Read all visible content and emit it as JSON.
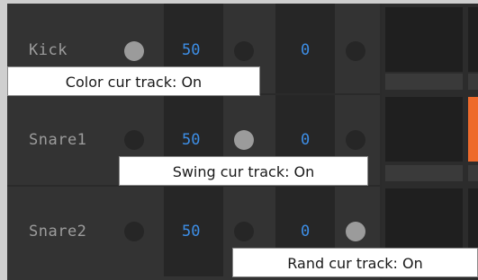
{
  "tracks": [
    {
      "name": "Kick",
      "swing": "50",
      "rand": "0",
      "color_dot_on": true,
      "swing_dot_on": false,
      "rand_dot_on": false
    },
    {
      "name": "Snare1",
      "swing": "50",
      "rand": "0",
      "color_dot_on": false,
      "swing_dot_on": true,
      "rand_dot_on": false
    },
    {
      "name": "Snare2",
      "swing": "50",
      "rand": "0",
      "color_dot_on": false,
      "swing_dot_on": false,
      "rand_dot_on": true
    }
  ],
  "tooltips": {
    "color": "Color cur track: On",
    "swing": "Swing cur track: On",
    "rand": "Rand cur track: On"
  },
  "colors": {
    "value_blue": "#3d8ee6",
    "dot_on": "#9b9b9b",
    "step_active": "#ee6a2c"
  },
  "icons": {
    "toggle": "circle-toggle-icon"
  }
}
